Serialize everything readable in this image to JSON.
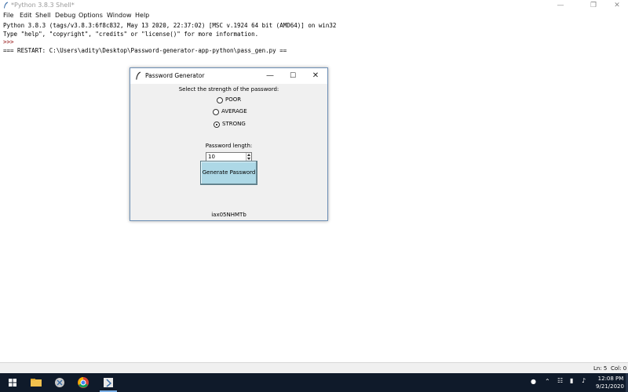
{
  "shell": {
    "title": "*Python 3.8.3 Shell*",
    "menu": [
      "File",
      "Edit",
      "Shell",
      "Debug",
      "Options",
      "Window",
      "Help"
    ],
    "console_lines": [
      "Python 3.8.3 (tags/v3.8.3:6f8c832, May 13 2020, 22:37:02) [MSC v.1924 64 bit (AMD64)] on win32",
      "Type \"help\", \"copyright\", \"credits\" or \"license()\" for more information.",
      ">>> ",
      "=== RESTART: C:\\Users\\adity\\Desktop\\Password-generator-app-python\\pass_gen.py =="
    ],
    "status": {
      "ln": "Ln: 5",
      "col": "Col: 0"
    }
  },
  "dialog": {
    "title": "Password Generator",
    "prompt": "Select the strength of the password:",
    "options": [
      {
        "label": "POOR",
        "selected": false
      },
      {
        "label": "AVERAGE",
        "selected": false
      },
      {
        "label": "STRONG",
        "selected": true
      }
    ],
    "length_label": "Password length:",
    "length_value": "10",
    "generate_label": "Generate Password",
    "output": "iax05NHMTb"
  },
  "taskbar": {
    "time": "12:08 PM",
    "date": "9/21/2020"
  },
  "colors": {
    "button_bg": "#add8e6",
    "taskbar_bg": "#0f1a2a",
    "prompt_red": "#8b0000"
  }
}
